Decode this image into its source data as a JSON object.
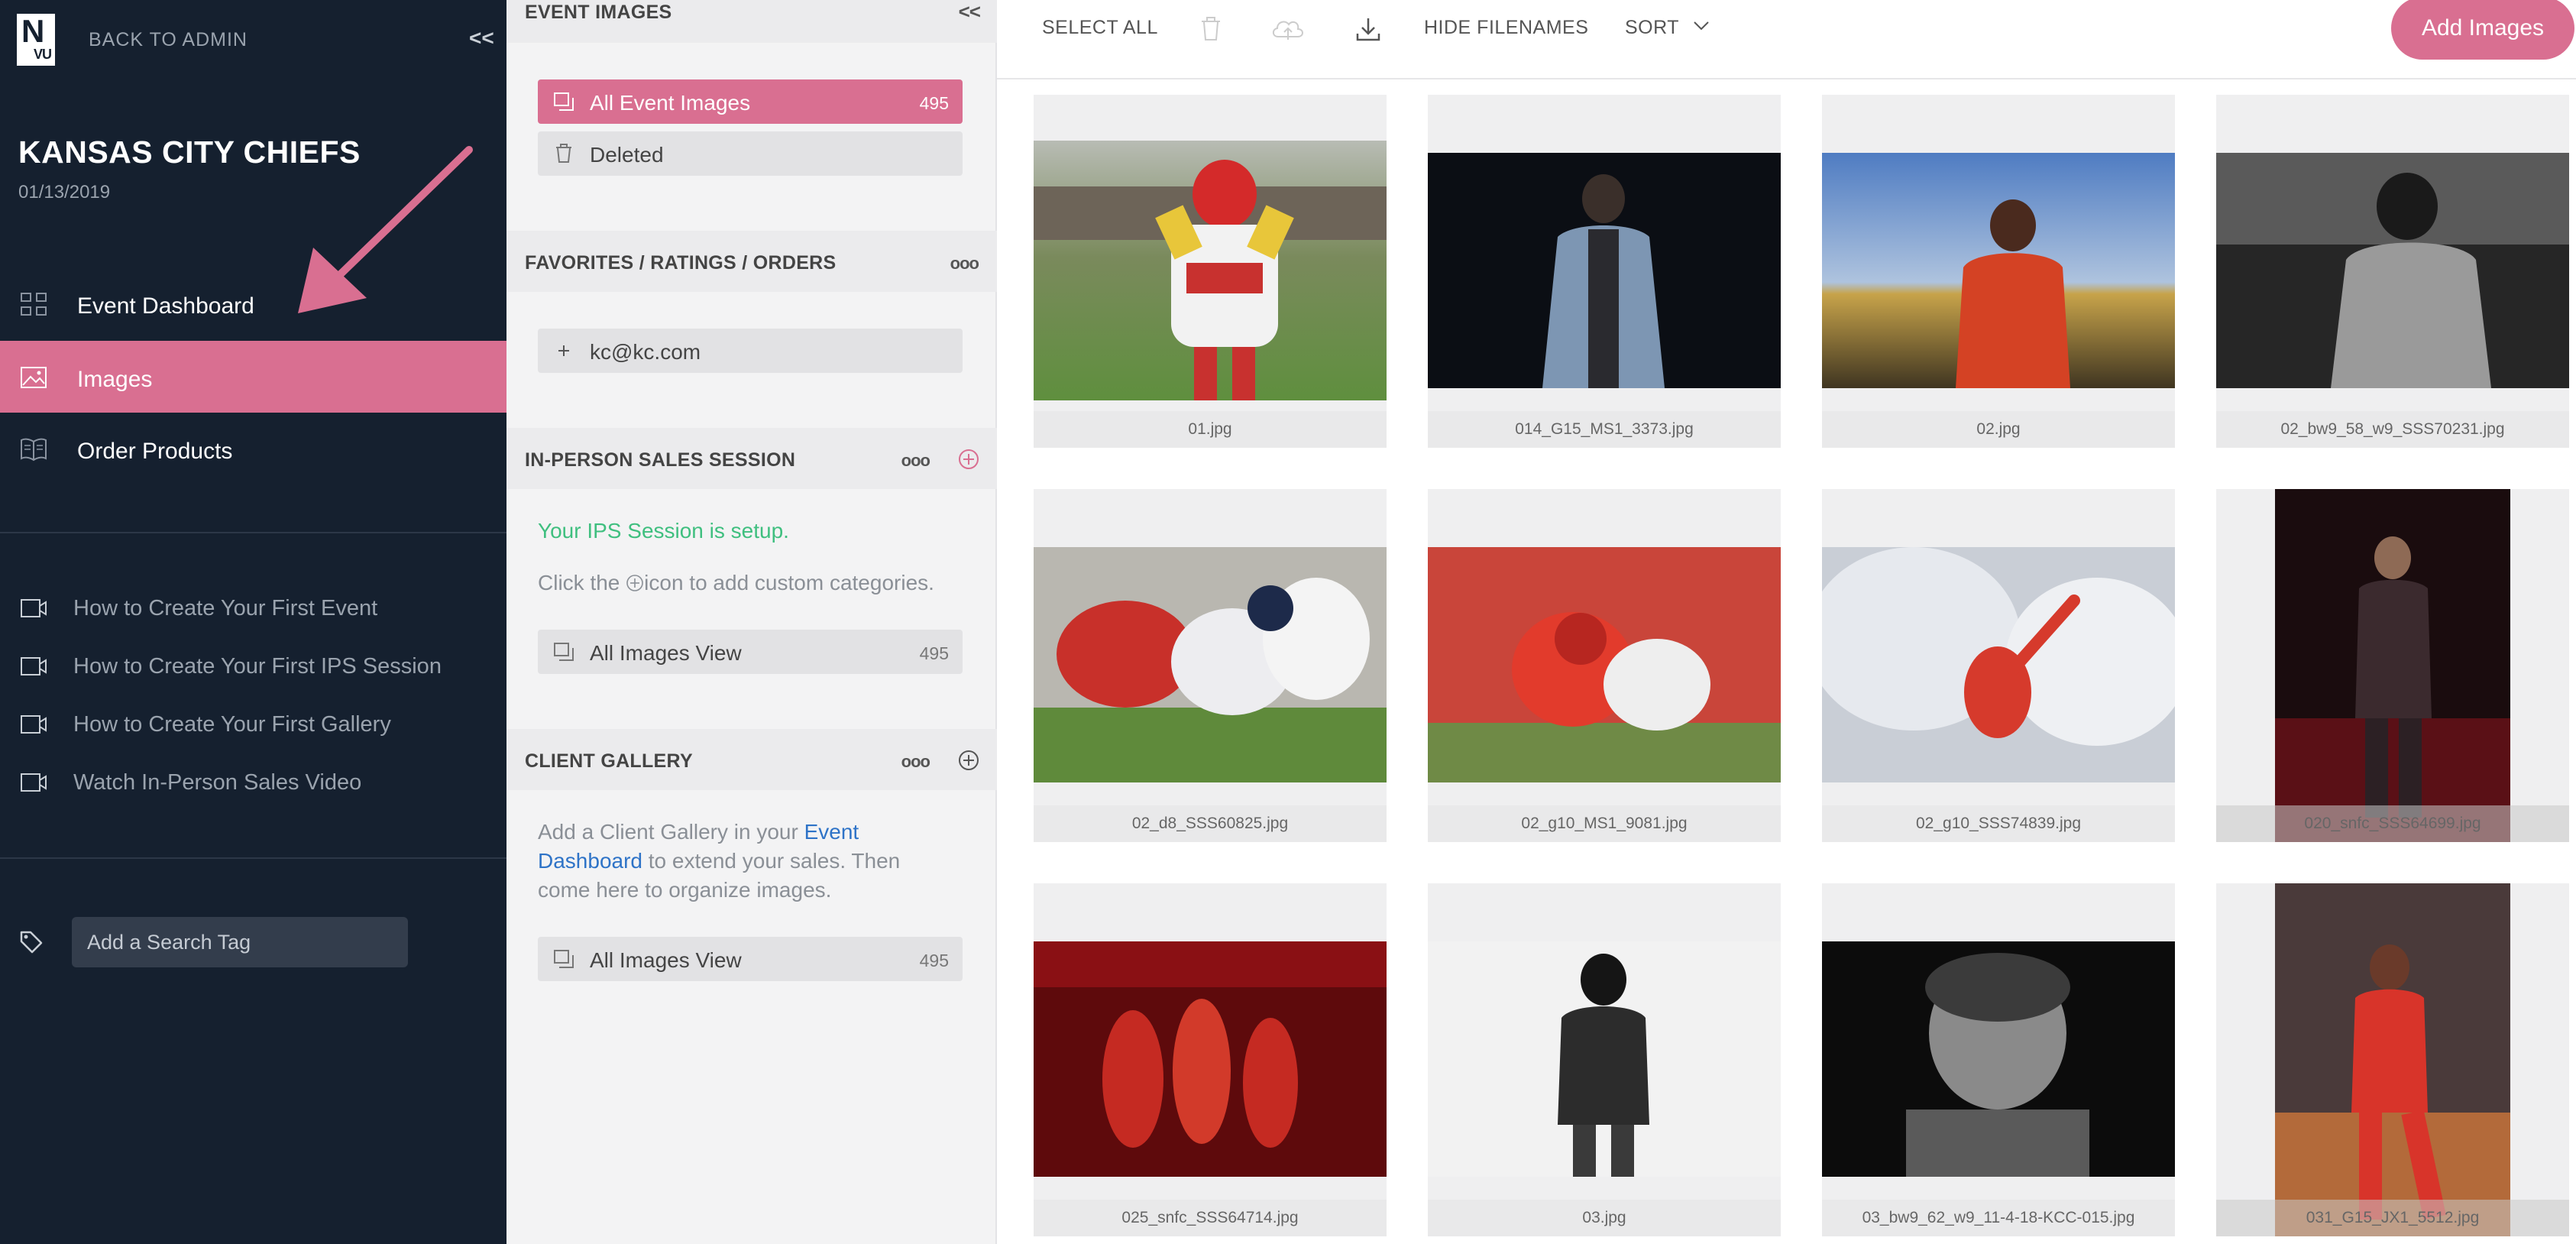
{
  "sidebar": {
    "logo_n": "N",
    "logo_vu": "VU",
    "back_label": "BACK TO ADMIN",
    "collapse_label": "<<",
    "event_title": "KANSAS CITY CHIEFS",
    "event_date": "01/13/2019",
    "nav": [
      {
        "label": "Event Dashboard",
        "icon": "grid-icon"
      },
      {
        "label": "Images",
        "icon": "image-icon",
        "active": true
      },
      {
        "label": "Order Products",
        "icon": "book-icon"
      }
    ],
    "help_links": [
      {
        "label": "How to Create Your First Event",
        "icon": "video-icon"
      },
      {
        "label": "How to Create Your First IPS Session",
        "icon": "video-icon"
      },
      {
        "label": "How to Create Your First Gallery",
        "icon": "video-icon"
      },
      {
        "label": "Watch In-Person Sales Video",
        "icon": "video-icon"
      }
    ],
    "search_tag_placeholder": "Add a Search Tag"
  },
  "middle": {
    "event_images": {
      "title": "EVENT IMAGES",
      "collapse_label": "<<",
      "items": [
        {
          "label": "All Event Images",
          "count": "495",
          "active": true
        },
        {
          "label": "Deleted"
        }
      ]
    },
    "favorites": {
      "title": "FAVORITES / RATINGS / ORDERS",
      "dots": "ooo",
      "item_label": "kc@kc.com"
    },
    "ips": {
      "title": "IN-PERSON SALES SESSION",
      "dots": "ooo",
      "status": "Your IPS Session is setup.",
      "hint_before": "Click the ",
      "hint_after": "icon to add custom categories.",
      "view_label": "All Images View",
      "view_count": "495"
    },
    "client_gallery": {
      "title": "CLIENT GALLERY",
      "dots": "ooo",
      "text_1": "Add a Client Gallery in your ",
      "link_1": "Event",
      "link_2": "Dashboard",
      "text_2": " to extend your sales. Then",
      "text_3": "come here to organize images.",
      "view_label": "All Images View",
      "view_count": "495"
    }
  },
  "toolbar": {
    "select_all": "SELECT ALL",
    "hide_filenames": "HIDE FILENAMES",
    "sort": "SORT",
    "add_images": "Add Images"
  },
  "images": [
    {
      "filename": "01.jpg"
    },
    {
      "filename": "014_G15_MS1_3373.jpg"
    },
    {
      "filename": "02.jpg"
    },
    {
      "filename": "02_bw9_58_w9_SSS70231.jpg"
    },
    {
      "filename": "02_d8_SSS60825.jpg"
    },
    {
      "filename": "02_g10_MS1_9081.jpg"
    },
    {
      "filename": "02_g10_SSS74839.jpg"
    },
    {
      "filename": "020_snfc_SSS64699.jpg"
    },
    {
      "filename": "025_snfc_SSS64714.jpg"
    },
    {
      "filename": "03.jpg"
    },
    {
      "filename": "03_bw9_62_w9_11-4-18-KCC-015.jpg"
    },
    {
      "filename": "031_G15_JX1_5512.jpg"
    }
  ],
  "colors": {
    "sidebar_bg": "#15202f",
    "accent_pink": "#d96f91",
    "ips_green": "#3fbf7f",
    "link_blue": "#2e73c7"
  }
}
